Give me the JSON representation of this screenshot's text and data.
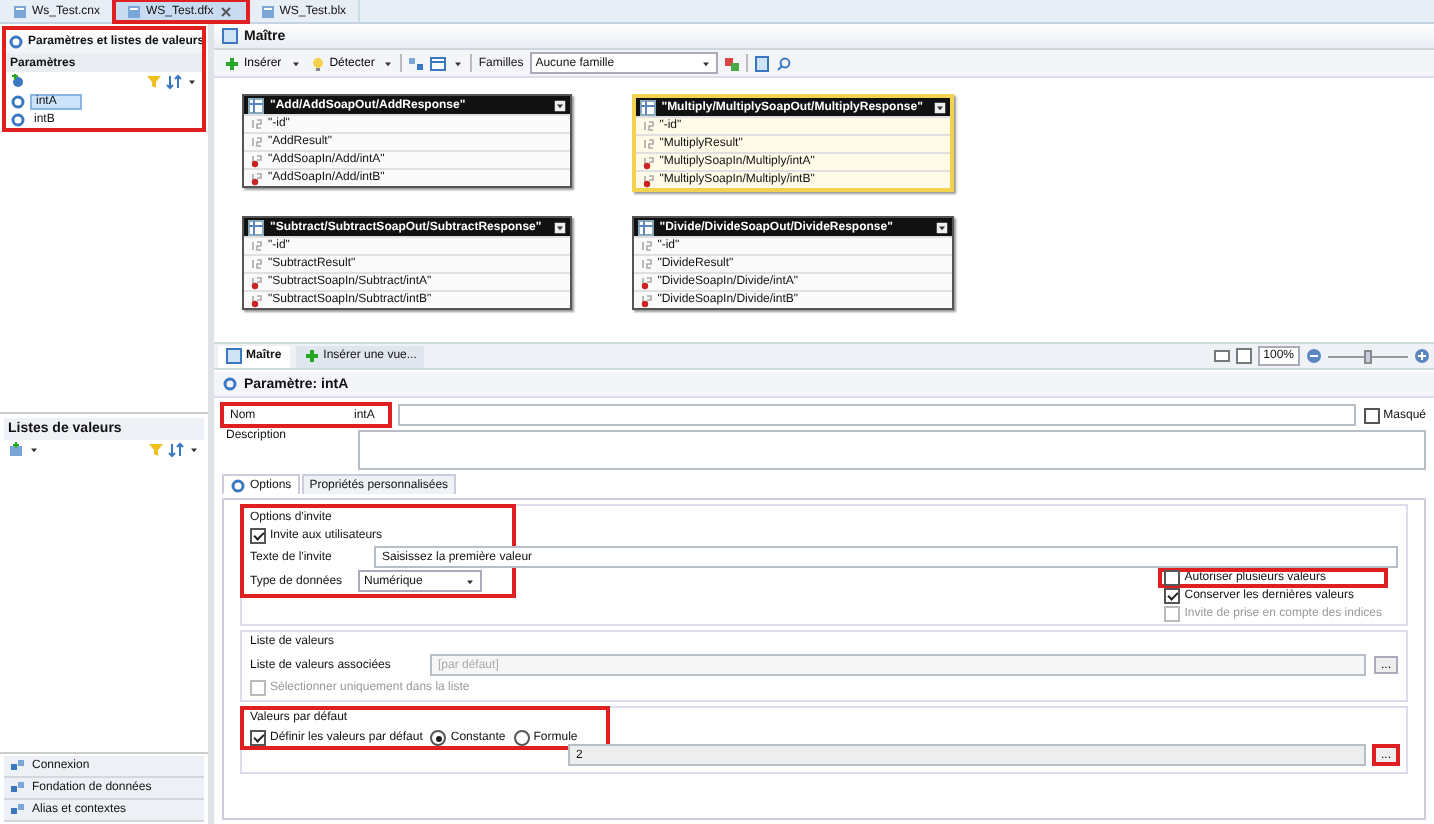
{
  "file_tabs": [
    {
      "label": "Ws_Test.cnx",
      "selected": false,
      "highlighted": false
    },
    {
      "label": "WS_Test.dfx",
      "selected": true,
      "highlighted": true
    },
    {
      "label": "WS_Test.blx",
      "selected": false,
      "highlighted": false
    }
  ],
  "left_panel": {
    "title": "Paramètres et listes de valeurs",
    "highlighted": true,
    "section": "Paramètres",
    "parameters": [
      {
        "label": "intA",
        "selected": true
      },
      {
        "label": "intB",
        "selected": false
      }
    ]
  },
  "value_lists": {
    "title": "Listes de valeurs"
  },
  "nav_items": [
    "Connexion",
    "Fondation de données",
    "Alias et contextes"
  ],
  "master": {
    "title": "Maître",
    "toolbar": {
      "insert": "Insérer",
      "detect": "Détecter",
      "families_label": "Familles",
      "families_value": "Aucune famille"
    },
    "tables": [
      {
        "title": "\"Add/AddSoapOut/AddResponse\"",
        "selected": false,
        "columns": [
          {
            "name": "\"-id\"",
            "kind": "number"
          },
          {
            "name": "\"AddResult\"",
            "kind": "number"
          },
          {
            "name": "\"AddSoapIn/Add/intA\"",
            "kind": "input"
          },
          {
            "name": "\"AddSoapIn/Add/intB\"",
            "kind": "input"
          }
        ]
      },
      {
        "title": "\"Multiply/MultiplySoapOut/MultiplyResponse\"",
        "selected": true,
        "columns": [
          {
            "name": "\"-id\"",
            "kind": "number"
          },
          {
            "name": "\"MultiplyResult\"",
            "kind": "number"
          },
          {
            "name": "\"MultiplySoapIn/Multiply/intA\"",
            "kind": "input"
          },
          {
            "name": "\"MultiplySoapIn/Multiply/intB\"",
            "kind": "input"
          }
        ]
      },
      {
        "title": "\"Subtract/SubtractSoapOut/SubtractResponse\"",
        "selected": false,
        "columns": [
          {
            "name": "\"-id\"",
            "kind": "number"
          },
          {
            "name": "\"SubtractResult\"",
            "kind": "number"
          },
          {
            "name": "\"SubtractSoapIn/Subtract/intA\"",
            "kind": "input"
          },
          {
            "name": "\"SubtractSoapIn/Subtract/intB\"",
            "kind": "input"
          }
        ]
      },
      {
        "title": "\"Divide/DivideSoapOut/DivideResponse\"",
        "selected": false,
        "columns": [
          {
            "name": "\"-id\"",
            "kind": "number"
          },
          {
            "name": "\"DivideResult\"",
            "kind": "number"
          },
          {
            "name": "\"DivideSoapIn/Divide/intA\"",
            "kind": "input"
          },
          {
            "name": "\"DivideSoapIn/Divide/intB\"",
            "kind": "input"
          }
        ]
      }
    ]
  },
  "view_tabs": [
    {
      "label": "Maître",
      "selected": true
    },
    {
      "label": "Insérer une vue...",
      "selected": false
    }
  ],
  "zoom": {
    "value": "100%",
    "level": 0.5
  },
  "parameter": {
    "title": "Paramètre: intA",
    "name_label": "Nom",
    "name_value": "intA",
    "name_highlighted": true,
    "hidden_label": "Masqué",
    "hidden_checked": false,
    "description_label": "Description"
  },
  "option_tabs": [
    {
      "label": "Options",
      "selected": true
    },
    {
      "label": "Propriétés personnalisées",
      "selected": false
    }
  ],
  "prompt_options": {
    "title": "Options d'invite",
    "highlighted": true,
    "prompt_users": {
      "label": "Invite aux utilisateurs",
      "checked": true
    },
    "prompt_text_label": "Texte de l'invite",
    "prompt_text_value": "Saisissez la première valeur",
    "data_type_label": "Type de données",
    "data_type_value": "Numérique"
  },
  "right_options": [
    {
      "label": "Autoriser plusieurs valeurs",
      "checked": false,
      "disabled": false,
      "highlighted": true
    },
    {
      "label": "Conserver les dernières valeurs",
      "checked": true,
      "disabled": false,
      "highlighted": false
    },
    {
      "label": "Invite de prise en compte des indices",
      "checked": false,
      "disabled": true,
      "highlighted": false
    }
  ],
  "list_of_values": {
    "title": "Liste de valeurs",
    "associated_label": "Liste de valeurs associées",
    "associated_placeholder": "[par défaut]",
    "browse": "...",
    "select_only": {
      "label": "Sélectionner uniquement dans la liste",
      "checked": false,
      "disabled": true
    }
  },
  "defaults": {
    "title": "Valeurs par défaut",
    "highlighted": true,
    "define": {
      "label": "Définir les valeurs par défaut",
      "checked": true
    },
    "modes": [
      {
        "label": "Constante",
        "selected": true
      },
      {
        "label": "Formule",
        "selected": false
      }
    ],
    "value": "2",
    "browse": "...",
    "browse_highlighted": true
  }
}
